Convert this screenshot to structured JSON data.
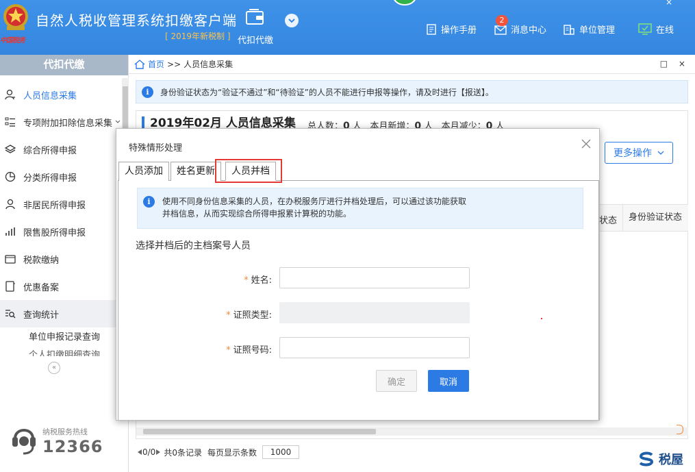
{
  "header": {
    "app_title": "自然人税收管理系统扣缴客户端",
    "app_subtitle": "[ 2019年新税制 ]",
    "emblem_text": "中国税务",
    "module_label": "代扣代缴",
    "nav": {
      "manual": "操作手册",
      "messages": "消息中心",
      "messages_badge": "2",
      "org": "单位管理",
      "online": "在线"
    },
    "close_glyph": "×"
  },
  "sidebar": {
    "title": "代扣代缴",
    "items": [
      {
        "label": "人员信息采集",
        "icon": "person-icon"
      },
      {
        "label": "专项附加扣除信息采集",
        "icon": "list-icon"
      },
      {
        "label": "综合所得申报",
        "icon": "layers-icon"
      },
      {
        "label": "分类所得申报",
        "icon": "pie-icon"
      },
      {
        "label": "非居民所得申报",
        "icon": "person-outline-icon"
      },
      {
        "label": "限售股所得申报",
        "icon": "bar-chart-icon"
      },
      {
        "label": "税款缴纳",
        "icon": "wallet-icon"
      },
      {
        "label": "优惠备案",
        "icon": "document-icon"
      },
      {
        "label": "查询统计",
        "icon": "search-list-icon"
      }
    ],
    "sub_items": [
      "单位申报记录查询",
      "个人扣缴明细查询"
    ],
    "collapse_glyph": "«",
    "hotline_label": "纳税服务热线",
    "hotline_number": "12366"
  },
  "breadcrumb": {
    "home": "首页",
    "separator": ">>",
    "current": "人员信息采集",
    "window_controls": "□ ×"
  },
  "notice": {
    "text": "身份验证状态为“验证不通过”和“待验证”的人员不能进行申报等操作，请及时进行【报送】。"
  },
  "panel": {
    "title": "2019年02月  人员信息采集",
    "stats": {
      "total_label": "总人数：",
      "total_value": "0",
      "new_label": "本月新增：",
      "new_value": "0",
      "reduce_label": "本月减少：",
      "reduce_value": "0",
      "unit": "人"
    },
    "more_button": "更多操作",
    "columns": {
      "status": "状态",
      "verify": "身份验证状态"
    }
  },
  "pager": {
    "page": "0/0",
    "total": "共0条记录",
    "per_page_label": "每页显示条数",
    "per_page_value": "1000"
  },
  "watermark": "税屋",
  "modal": {
    "title": "特殊情形处理",
    "tabs": [
      "人员添加",
      "姓名更新",
      "人员并档"
    ],
    "active_tab": 2,
    "notice_line1": "使用不同身份信息采集的人员，在办税服务厅进行并档处理后，可以通过该功能获取",
    "notice_line2": "并档信息，从而实现综合所得申报累计算税的功能。",
    "section_label": "选择并档后的主档案号人员",
    "fields": {
      "name_label": "姓名:",
      "idtype_label": "证照类型:",
      "idnum_label": "证照号码:",
      "required_mark": "*"
    },
    "ok_button": "确定",
    "cancel_button": "取消"
  },
  "colors": {
    "header_blue": "#3a8ee6",
    "accent_blue": "#2c7be5",
    "subtitle_orange": "#ffc24a",
    "required_orange": "#f08a3a",
    "highlight_red": "#e53935"
  }
}
